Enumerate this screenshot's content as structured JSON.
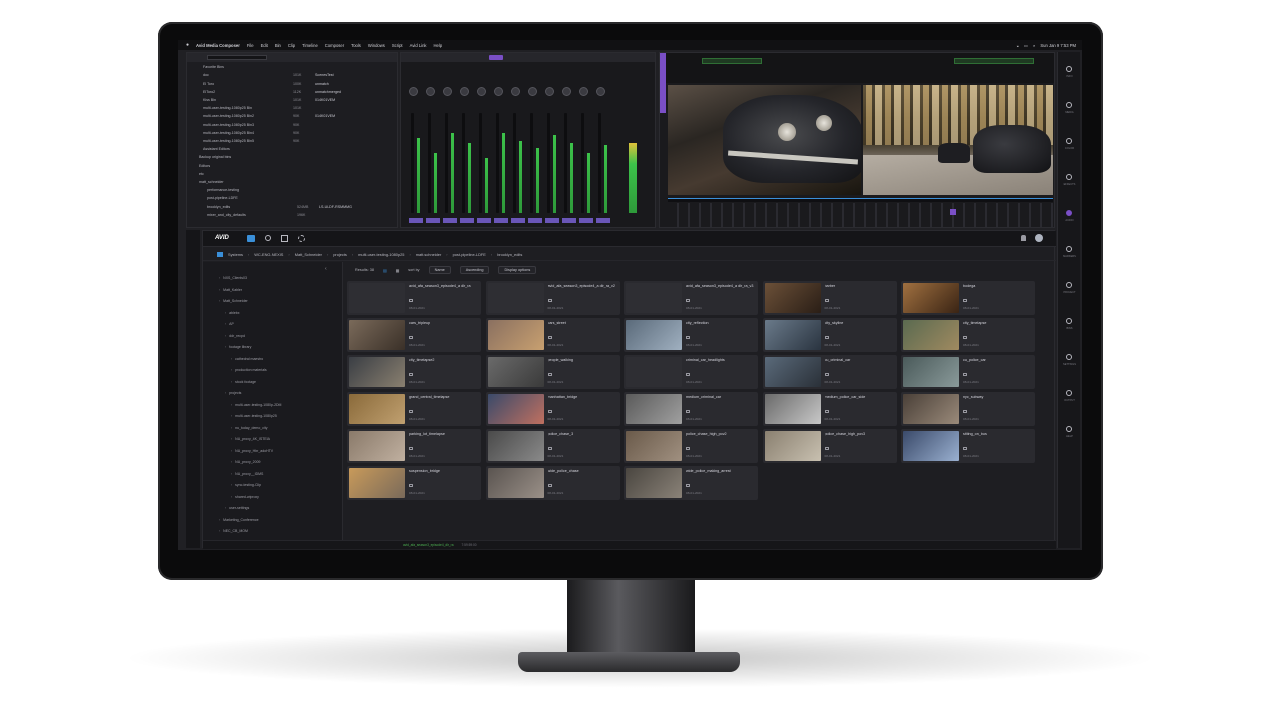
{
  "menubar": {
    "app_name": "Avid Media Composer",
    "items": [
      "File",
      "Edit",
      "Bin",
      "Clip",
      "Timeline",
      "Composer",
      "Tools",
      "Windows",
      "Script",
      "Avid Link",
      "Help"
    ],
    "clock": "Sun Jan 9 7:53 PM"
  },
  "bins_panel": {
    "rows": [
      {
        "name": "Favorite Bins",
        "c1": "",
        "c2": ""
      },
      {
        "name": "doc",
        "c1": "101K",
        "c2": "ScenesTest"
      },
      {
        "name": "El Toro",
        "c1": "100K",
        "c2": "unmatch"
      },
      {
        "name": "ElToro2",
        "c1": "112K",
        "c2": "unmatchmerged"
      },
      {
        "name": "Kiss Bin",
        "c1": "101K",
        "c2": "014K01VEM"
      },
      {
        "name": "multi-user-testing-1080p25 Bin",
        "c1": "101K",
        "c2": ""
      },
      {
        "name": "multi-user-testing-1080p25 Bin2",
        "c1": "90K",
        "c2": "014K01VEM"
      },
      {
        "name": "multi-user-testing-1080p25 Bin3",
        "c1": "90K",
        "c2": ""
      },
      {
        "name": "multi-user-testing-1080p25 Bin4",
        "c1": "90K",
        "c2": ""
      },
      {
        "name": "multi-user-testing-1080p25 Bin5",
        "c1": "90K",
        "c2": ""
      },
      {
        "name": "Assistant Editors",
        "c1": "",
        "c2": ""
      },
      {
        "name": "Backup original bins",
        "c1": "",
        "c2": ""
      },
      {
        "name": "Editors",
        "c1": "",
        "c2": ""
      },
      {
        "name": "etc",
        "c1": "",
        "c2": ""
      },
      {
        "name": "matt_schneider",
        "c1": "",
        "c2": ""
      },
      {
        "name": "performance-testing",
        "c1": "",
        "c2": ""
      },
      {
        "name": "post-pipeline-LDFE",
        "c1": "",
        "c2": ""
      },
      {
        "name": "brooklyn_edits",
        "c1": "524MB",
        "c2": "LS-ULDF-RSMMMG"
      },
      {
        "name": "mixer_and_city_defaults",
        "c1": "196K",
        "c2": ""
      }
    ]
  },
  "breadcrumb": [
    "Systems",
    "WC-ENG-NEXIS",
    "Matt_Schneider",
    "projects",
    "multi-user-testing-1080p25",
    "matt.schneider",
    "post-pipeline-LDFE",
    "brooklyn_edits"
  ],
  "toolbar": {
    "results": "Results: 38",
    "sort_label": "sort by",
    "sort_value": "Name",
    "order_value": "Ascending",
    "display_options": "Display options"
  },
  "tree": [
    "NXS_Clients03",
    "Matt_Kabler",
    "Matt_Schneider",
    "ablebx",
    "AP",
    "ddr_recpd",
    "footage library",
    "cathedral maestro",
    "production materials",
    "stock footage",
    "projects",
    "multi-user-testing-1080p-2DM",
    "multi-user-testing-1080p25",
    "nu_today_demo_city",
    "NU_proxy_4K_ISTEIA",
    "NU_proxy_Hbr_adoHTV",
    "NU_proxy_2009",
    "NU_proxy__IDMS",
    "sync-testing-Clip",
    "shared-wiproxy",
    "user-settings",
    "Marketing_Conference",
    "NEC_CB_MOM"
  ],
  "clips": [
    {
      "title": "avid_afa_season3_episode4_a dlr_ra",
      "date": "08-01-2021"
    },
    {
      "title": "avid_afa_season3_episode4_a dlr_ra_v2",
      "date": "08-01-2021"
    },
    {
      "title": "avid_afa_season3_episode4_a dlr_ra_v3",
      "date": "08-01-2021"
    },
    {
      "title": "barber",
      "date": "08-01-2021"
    },
    {
      "title": "bodega",
      "date": "08-01-2021"
    },
    {
      "title": "cars_tripleup",
      "date": "08-01-2021"
    },
    {
      "title": "cars_street",
      "date": "08-01-2021"
    },
    {
      "title": "city_reflection",
      "date": "08-01-2021"
    },
    {
      "title": "city_skyline",
      "date": "08-01-2021"
    },
    {
      "title": "city_timelapse",
      "date": "08-01-2021"
    },
    {
      "title": "city_timelapse2",
      "date": "08-01-2021"
    },
    {
      "title": "people_walking",
      "date": "08-01-2021"
    },
    {
      "title": "criminal_car_headlights",
      "date": "08-01-2021"
    },
    {
      "title": "cu_criminal_car",
      "date": "08-01-2021"
    },
    {
      "title": "cu_police_car",
      "date": "08-01-2021"
    },
    {
      "title": "grand_central_timelapse",
      "date": "08-01-2021"
    },
    {
      "title": "manhattan_bridge",
      "date": "08-01-2021"
    },
    {
      "title": "medium_criminal_car",
      "date": "08-01-2021"
    },
    {
      "title": "medium_police_car_side",
      "date": "08-01-2021"
    },
    {
      "title": "nyc_subway",
      "date": "08-01-2021"
    },
    {
      "title": "parking_lot_timelapse",
      "date": "08-01-2021"
    },
    {
      "title": "police_chase_3",
      "date": "08-01-2021"
    },
    {
      "title": "police_chase_high_pov2",
      "date": "08-01-2021"
    },
    {
      "title": "police_chase_high_pov3",
      "date": "08-01-2021"
    },
    {
      "title": "sitting_on_bus",
      "date": "08-01-2021"
    },
    {
      "title": "suspension_bridge",
      "date": "08-01-2021"
    },
    {
      "title": "wide_police_chase",
      "date": "08-01-2021"
    },
    {
      "title": "wide_police_making_arrest",
      "date": "08-01-2021"
    }
  ],
  "rightbar_labels": [
    "INFO",
    "MEDIA",
    "COLOR",
    "EFFECTS",
    "AUDIO",
    "MARKERS",
    "PROJECT",
    "BINS",
    "SETTINGS",
    "OUTPUT",
    "HELP"
  ],
  "status": {
    "left": "avid_afa_season3_episode4_dlr_ra",
    "right": "7:59:59:00"
  },
  "colors": {
    "accent": "#3a8fd8",
    "viewer_purple": "#7a4fc6",
    "meter_green": "#3cc24a"
  }
}
